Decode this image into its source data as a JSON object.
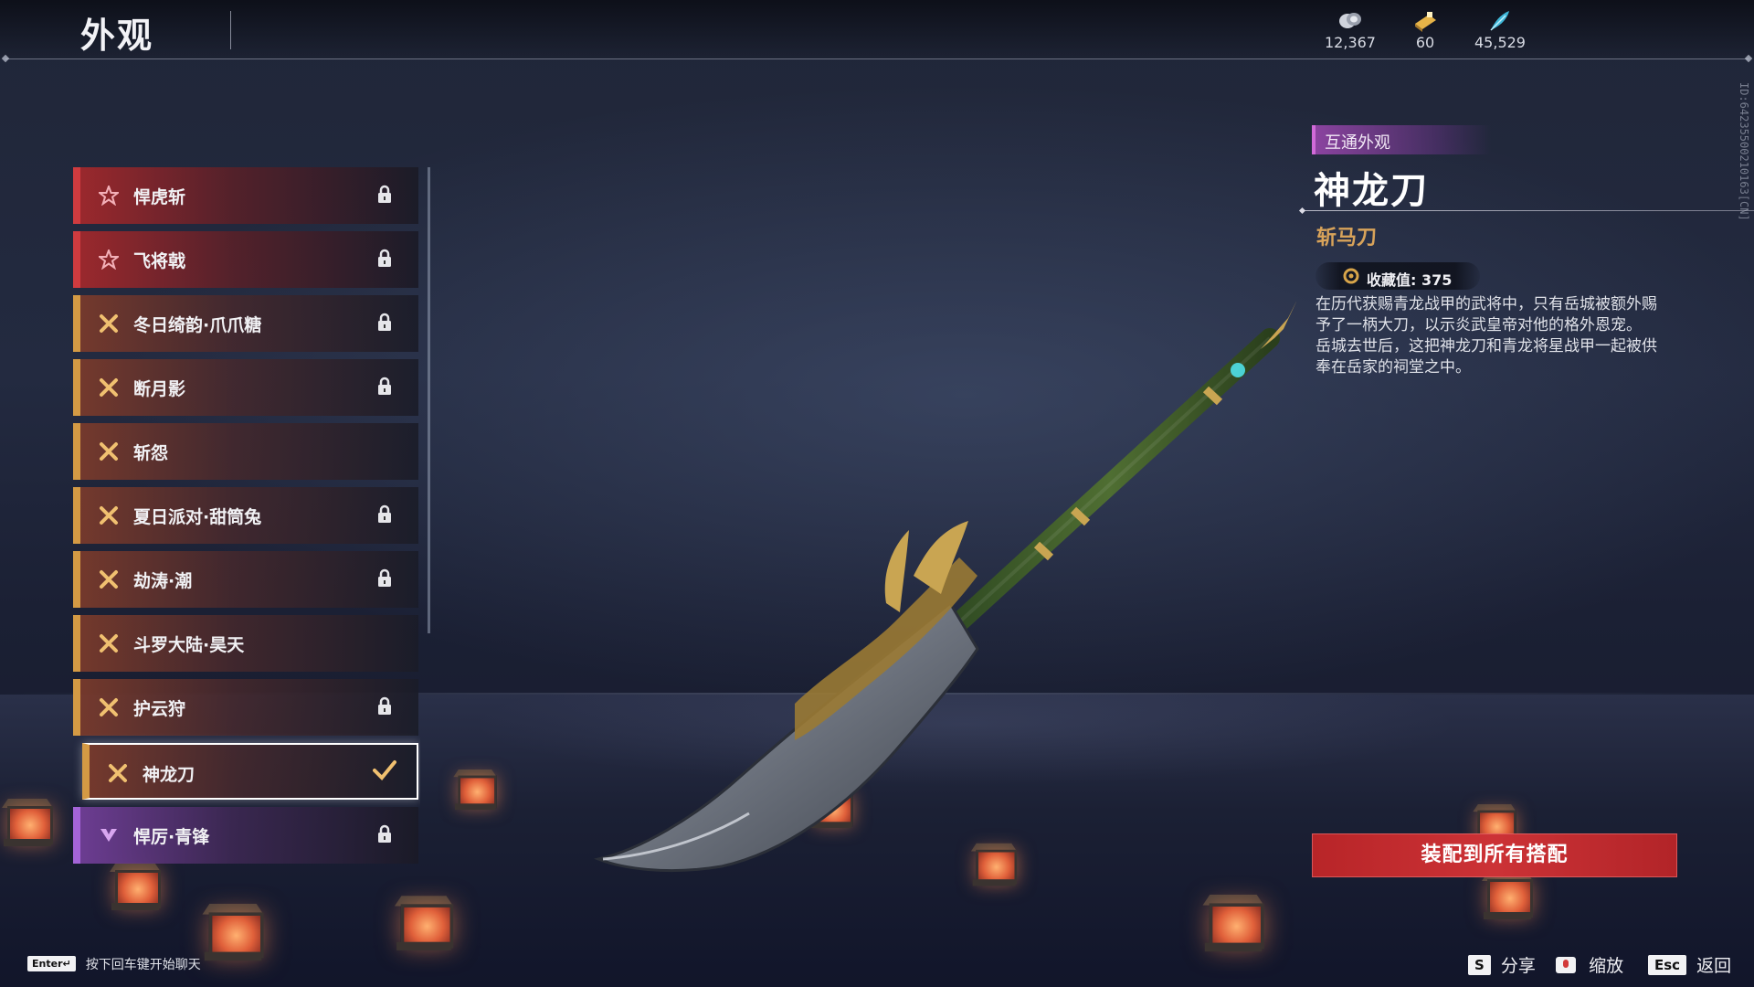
{
  "header": {
    "title": "外观"
  },
  "currencies": [
    {
      "icon": "silver-coin-icon",
      "value": "12,367"
    },
    {
      "icon": "gold-ticket-icon",
      "value": "60"
    },
    {
      "icon": "blue-feather-icon",
      "value": "45,529"
    }
  ],
  "list": {
    "items": [
      {
        "label": "悍虎斩",
        "tier": "red",
        "rank_icon": "star-icon",
        "locked": true,
        "selected": false
      },
      {
        "label": "飞将戟",
        "tier": "red",
        "rank_icon": "star-icon",
        "locked": true,
        "selected": false
      },
      {
        "label": "冬日绮韵·爪爪糖",
        "tier": "orange",
        "rank_icon": "cross-blades-icon",
        "locked": true,
        "selected": false
      },
      {
        "label": "断月影",
        "tier": "orange",
        "rank_icon": "cross-blades-icon",
        "locked": true,
        "selected": false
      },
      {
        "label": "斩怨",
        "tier": "orange",
        "rank_icon": "cross-blades-icon",
        "locked": false,
        "selected": false
      },
      {
        "label": "夏日派对·甜筒兔",
        "tier": "orange",
        "rank_icon": "cross-blades-icon",
        "locked": true,
        "selected": false
      },
      {
        "label": "劫涛·潮",
        "tier": "orange",
        "rank_icon": "cross-blades-icon",
        "locked": true,
        "selected": false
      },
      {
        "label": "斗罗大陆·昊天",
        "tier": "orange",
        "rank_icon": "cross-blades-icon",
        "locked": false,
        "selected": false
      },
      {
        "label": "护云狩",
        "tier": "orange",
        "rank_icon": "cross-blades-icon",
        "locked": true,
        "selected": false
      },
      {
        "label": "神龙刀",
        "tier": "orange",
        "rank_icon": "cross-blades-icon",
        "locked": false,
        "selected": true
      },
      {
        "label": "悍厉·青锋",
        "tier": "purple",
        "rank_icon": "chevron-gem-icon",
        "locked": true,
        "selected": false
      }
    ]
  },
  "detail": {
    "tag": "互通外观",
    "title": "神龙刀",
    "type": "斩马刀",
    "collection_label": "收藏值: 375",
    "description_lines": [
      "在历代获赐青龙战甲的武将中，只有岳城被额外赐",
      "予了一柄大刀，以示炎武皇帝对他的格外恩宠。",
      "岳城去世后，这把神龙刀和青龙将星战甲一起被供",
      "奉在岳家的祠堂之中。"
    ],
    "side_id": "ID:64235500210163[CN]",
    "equip_button": "装配到所有搭配"
  },
  "footer": {
    "chat_key": "Enter↵",
    "chat_hint": "按下回车键开始聊天",
    "hints": [
      {
        "key": "S",
        "label": "分享"
      },
      {
        "key": "zoom-icon",
        "label": "缩放"
      },
      {
        "key": "Esc",
        "label": "返回"
      }
    ]
  },
  "colors": {
    "tier_red": "#cf3b3f",
    "tier_orange": "#d49a44",
    "tier_purple": "#a464d8",
    "equip_button": "#cc3236",
    "type_text": "#d8a35a"
  }
}
